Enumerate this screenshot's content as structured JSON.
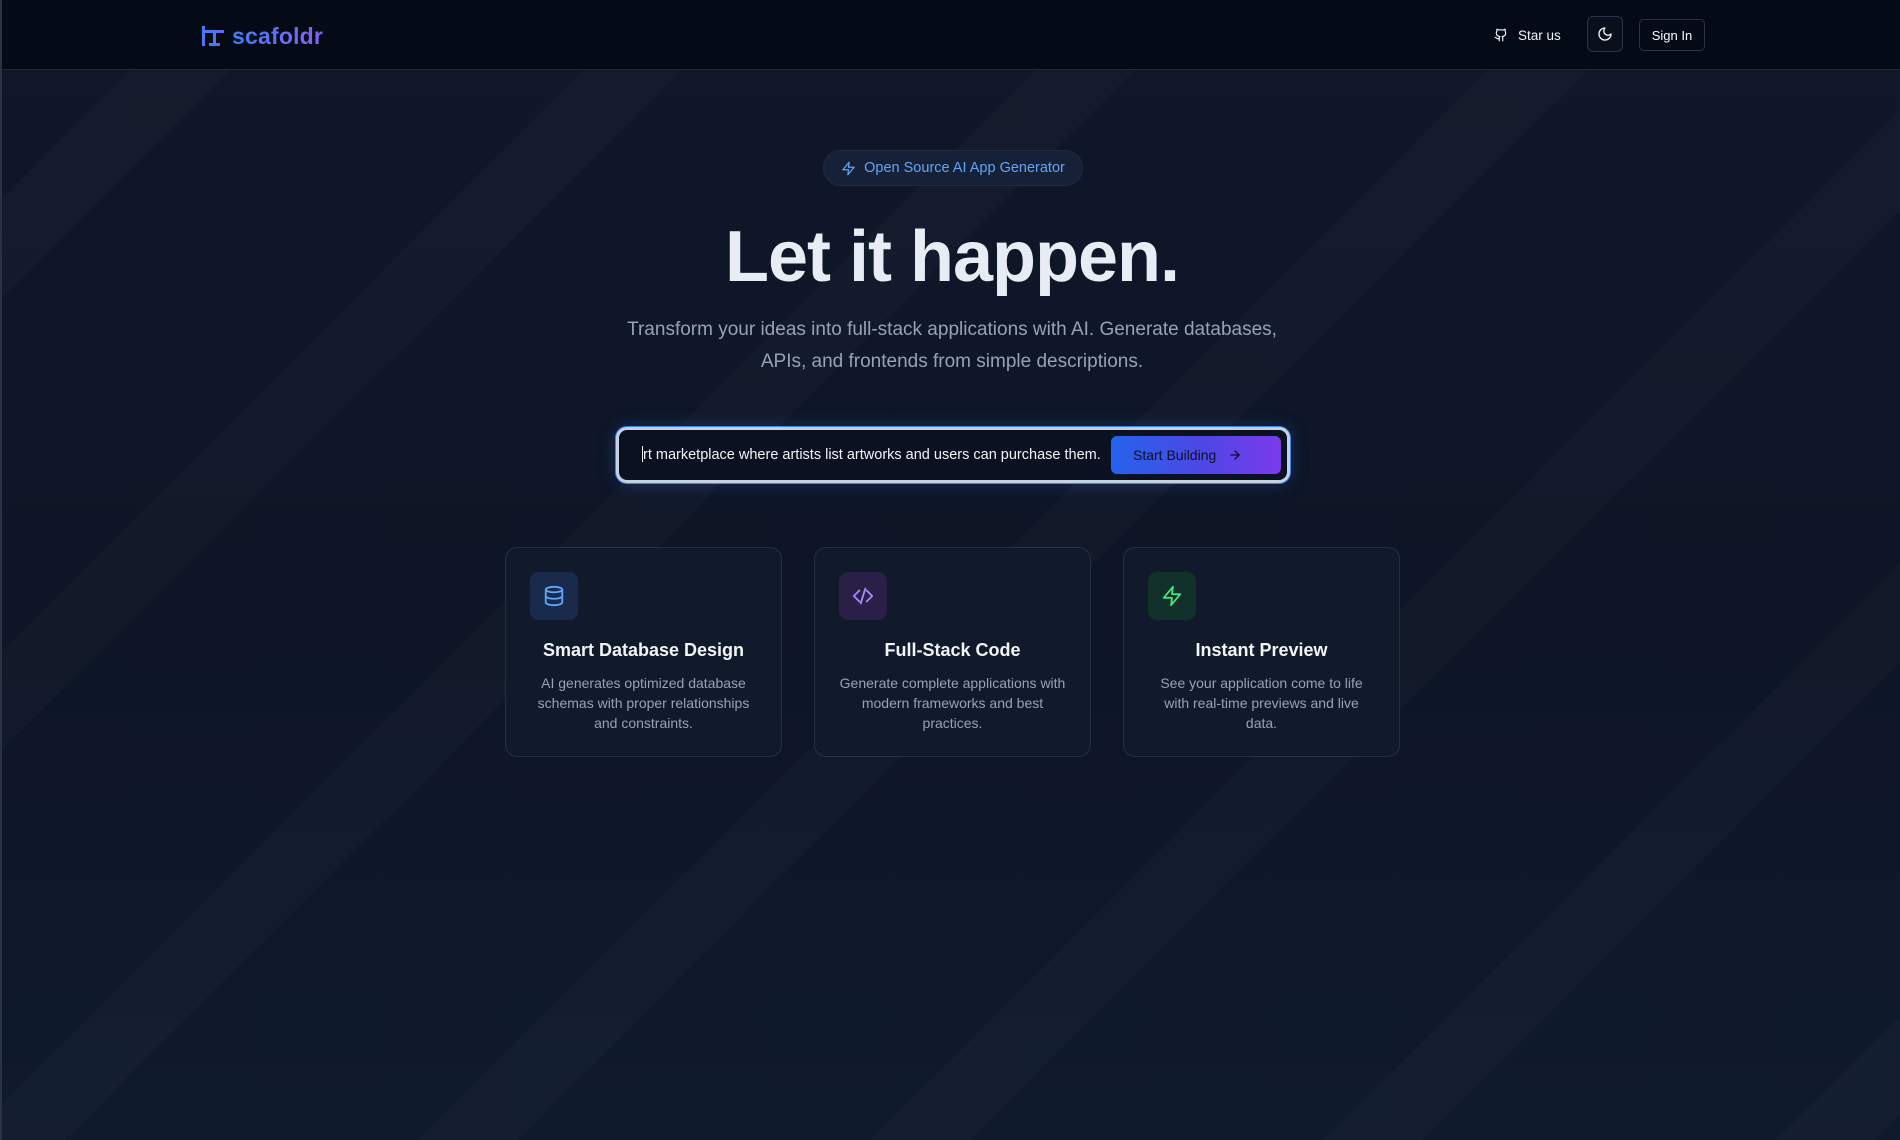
{
  "header": {
    "logo_text": "scafoldr",
    "star_label": "Star us",
    "signin_label": "Sign In"
  },
  "hero": {
    "badge_label": "Open Source AI App Generator",
    "title": "Let it happen.",
    "subtitle": "Transform your ideas into full-stack applications with AI. Generate databases, APIs, and frontends from simple descriptions."
  },
  "prompt": {
    "value": "rt marketplace where artists list artworks and users can purchase them.",
    "button_label": "Start Building"
  },
  "features": [
    {
      "icon": "database-icon",
      "title": "Smart Database Design",
      "description": "AI generates optimized database schemas with proper relationships and constraints.",
      "accent": "#60a5fa"
    },
    {
      "icon": "code-icon",
      "title": "Full-Stack Code",
      "description": "Generate complete applications with modern frameworks and best practices.",
      "accent": "#a78bfa"
    },
    {
      "icon": "lightning-icon",
      "title": "Instant Preview",
      "description": "See your application come to life with real-time previews and live data.",
      "accent": "#4ade80"
    }
  ],
  "colors": {
    "background": "#0b1120",
    "accent_blue": "#3b82f6",
    "accent_purple": "#7c3aed"
  }
}
